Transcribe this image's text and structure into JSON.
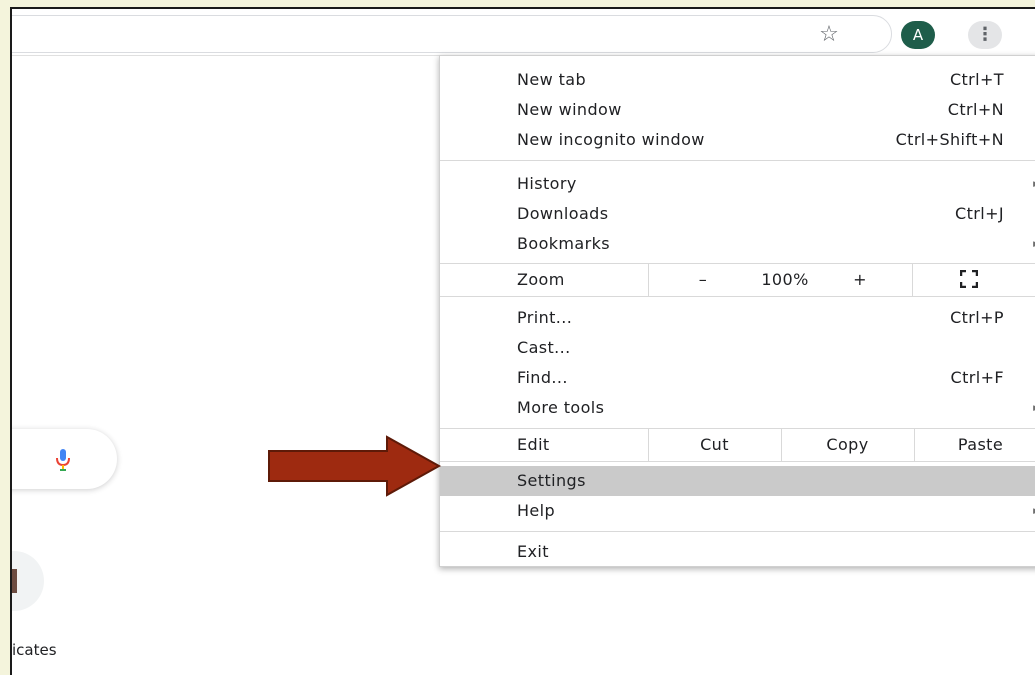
{
  "toolbar": {
    "star_icon": "☆",
    "avatar_letter": "A",
    "menu_icon": "⋮"
  },
  "page": {
    "shortcut_label": "icates"
  },
  "menu": {
    "group1": [
      {
        "label": "New tab",
        "shortcut": "Ctrl+T"
      },
      {
        "label": "New window",
        "shortcut": "Ctrl+N"
      },
      {
        "label": "New incognito window",
        "shortcut": "Ctrl+Shift+N"
      }
    ],
    "group2": [
      {
        "label": "History",
        "submenu": "►"
      },
      {
        "label": "Downloads",
        "shortcut": "Ctrl+J"
      },
      {
        "label": "Bookmarks",
        "submenu": "►"
      }
    ],
    "zoom": {
      "label": "Zoom",
      "minus": "–",
      "value": "100%",
      "plus": "+"
    },
    "group3": [
      {
        "label": "Print...",
        "shortcut": "Ctrl+P"
      },
      {
        "label": "Cast..."
      },
      {
        "label": "Find...",
        "shortcut": "Ctrl+F"
      },
      {
        "label": "More tools",
        "submenu": "►"
      }
    ],
    "edit": {
      "label": "Edit",
      "cut": "Cut",
      "copy": "Copy",
      "paste": "Paste"
    },
    "group4": [
      {
        "label": "Settings"
      },
      {
        "label": "Help",
        "submenu": "►"
      }
    ],
    "exit": {
      "label": "Exit"
    }
  },
  "colors": {
    "arrow_fill": "#9e2a10",
    "arrow_stroke": "#5e1a08",
    "avatar_bg": "#1e5d4a",
    "highlight": "#cacaca"
  }
}
